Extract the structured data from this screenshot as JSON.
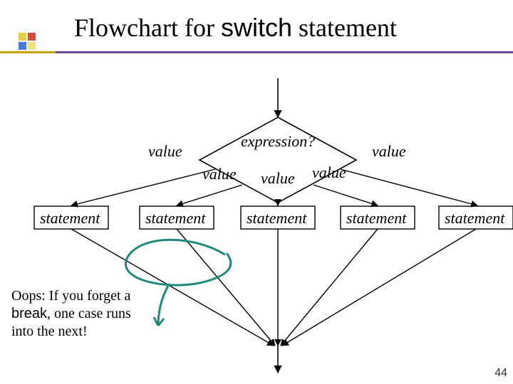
{
  "title": {
    "pre": "Flowchart for ",
    "code": "switch",
    "post": " statement"
  },
  "diagram": {
    "decision": "expression?",
    "values": {
      "v1": "value",
      "v2": "value",
      "v3": "value",
      "v4": "value",
      "v5": "value"
    },
    "statements": {
      "s1": "statement",
      "s2": "statement",
      "s3": "statement",
      "s4": "statement",
      "s5": "statement"
    }
  },
  "note": {
    "line1": "Oops: If you forget a",
    "kw": "break",
    "line2_tail": ", one case runs",
    "line3": "into the next!"
  },
  "page": "44"
}
